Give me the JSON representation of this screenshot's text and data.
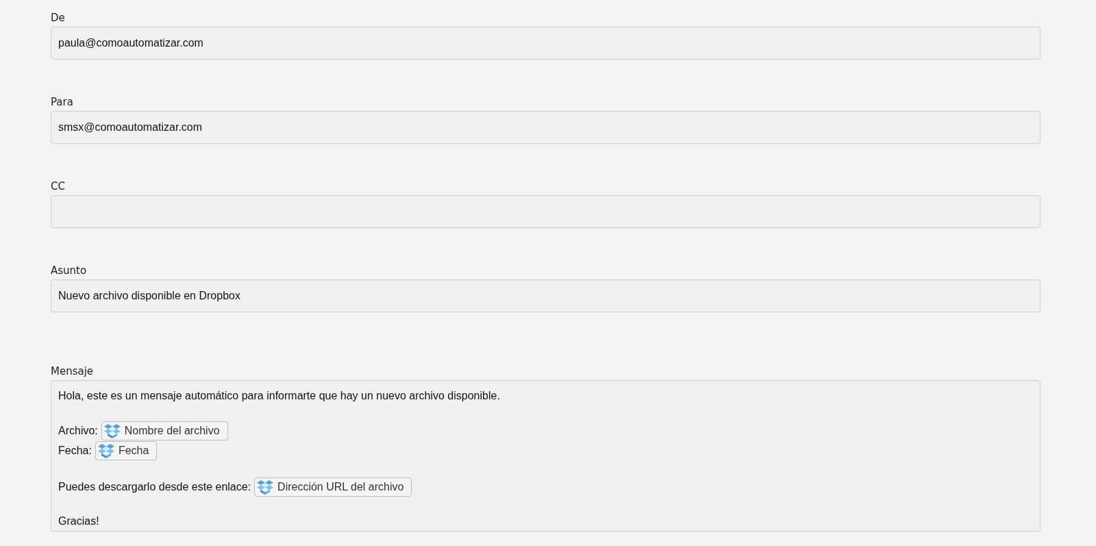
{
  "fields": [
    {
      "label": "De",
      "value": "paula@comoautomatizar.com"
    },
    {
      "label": "Para",
      "value": "smsx@comoautomatizar.com"
    },
    {
      "label": "CC"
    },
    {
      "label": "Asunto",
      "value": "Nuevo archivo disponible en Dropbox"
    }
  ],
  "message": {
    "label": "Mensaje",
    "lines": [
      {
        "kind": "text",
        "text": "Hola, este es un mensaje automático para informarte que hay un nuevo archivo disponible."
      },
      {
        "kind": "blank"
      },
      {
        "kind": "token",
        "text": "Archivo:",
        "token": "Nombre del archivo"
      },
      {
        "kind": "token",
        "text": "Fecha:",
        "token": "Fecha"
      },
      {
        "kind": "blank"
      },
      {
        "kind": "token",
        "text": "Puedes descargarlo desde este enlace:",
        "token": "Dirección URL del archivo"
      },
      {
        "kind": "blank"
      },
      {
        "kind": "text",
        "text": "Gracias!"
      }
    ]
  }
}
